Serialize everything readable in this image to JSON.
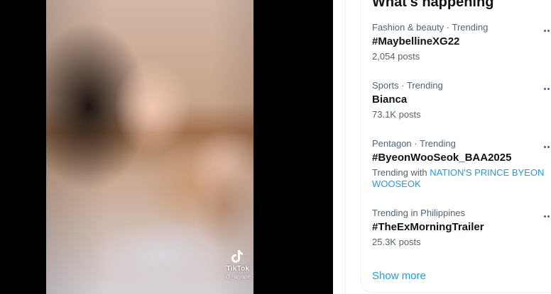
{
  "video": {
    "watermark": {
      "brand": "TikTok",
      "handle": "@_ajyape"
    }
  },
  "trends": {
    "title": "What's happening",
    "items": [
      {
        "meta": "Fashion & beauty · Trending",
        "name": "#MaybellineXG22",
        "count": "2,054 posts"
      },
      {
        "meta": "Sports · Trending",
        "name": "Bianca",
        "count": "73.1K posts"
      },
      {
        "meta": "Pentagon · Trending",
        "name": "#ByeonWooSeok_BAA2025",
        "with_prefix": "Trending with",
        "with_link": "NATION'S PRINCE BYEON WOOSEOK"
      },
      {
        "meta": "Trending in Philippines",
        "name": "#TheExMorningTrailer",
        "count": "25.3K posts"
      }
    ],
    "show_more": "Show more"
  },
  "colors": {
    "accent": "#1d9bf0",
    "text_primary": "#0f1419",
    "text_secondary": "#536471"
  }
}
